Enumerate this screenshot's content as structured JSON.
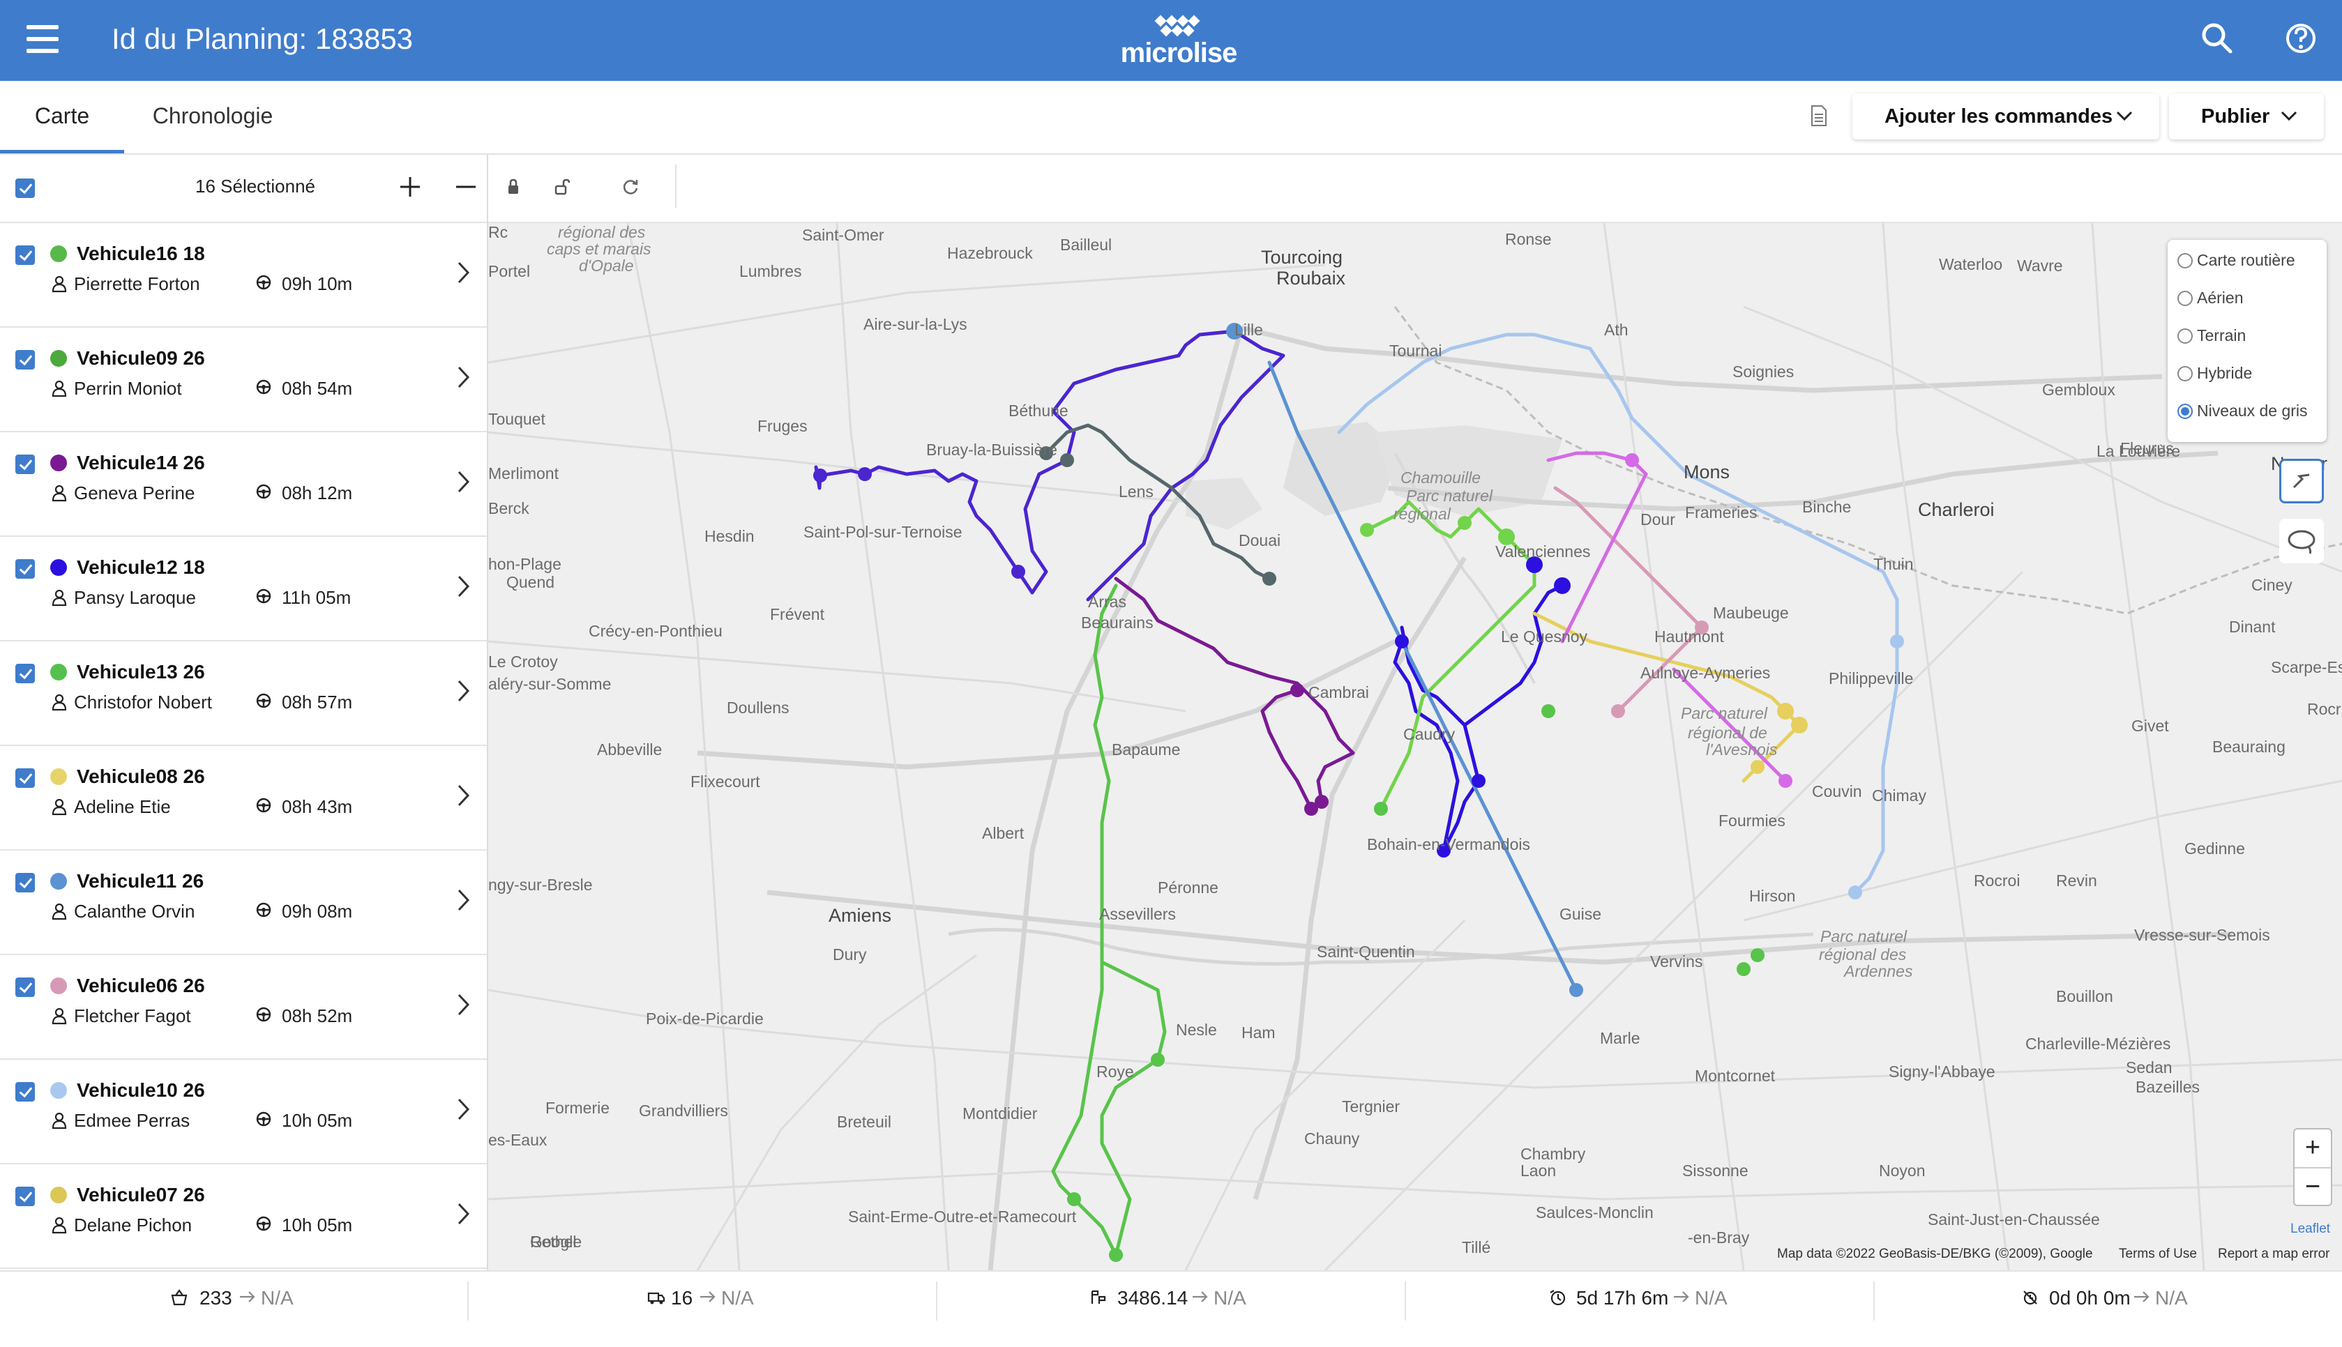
{
  "header": {
    "title": "Id du Planning: 183853",
    "logo_text": "microlise",
    "color": "#3f7ccc"
  },
  "tabs": [
    {
      "label": "Carte",
      "active": true
    },
    {
      "label": "Chronologie",
      "active": false
    }
  ],
  "actions": {
    "add_orders_label": "Ajouter les commandes",
    "publish_label": "Publier"
  },
  "selection": {
    "count_label": "16 Sélectionné"
  },
  "vehicles": [
    {
      "name": "Vehicule16 18",
      "driver": "Pierrette Forton",
      "time": "09h 10m",
      "color": "#58b84a"
    },
    {
      "name": "Vehicule09 26",
      "driver": "Perrin Moniot",
      "time": "08h 54m",
      "color": "#4ca93c"
    },
    {
      "name": "Vehicule14 26",
      "driver": "Geneva Perine",
      "time": "08h 12m",
      "color": "#7a1a93"
    },
    {
      "name": "Vehicule12 18",
      "driver": "Pansy Laroque",
      "time": "11h 05m",
      "color": "#2b10e0"
    },
    {
      "name": "Vehicule13 26",
      "driver": "Christofor Nobert",
      "time": "08h 57m",
      "color": "#55c04e"
    },
    {
      "name": "Vehicule08 26",
      "driver": "Adeline Etie",
      "time": "08h 43m",
      "color": "#e6d46a"
    },
    {
      "name": "Vehicule11 26",
      "driver": "Calanthe Orvin",
      "time": "09h 08m",
      "color": "#5b92d2"
    },
    {
      "name": "Vehicule06 26",
      "driver": "Fletcher Fagot",
      "time": "08h 52m",
      "color": "#d79ab6"
    },
    {
      "name": "Vehicule10 26",
      "driver": "Edmee Perras",
      "time": "10h 05m",
      "color": "#a9c8f0"
    },
    {
      "name": "Vehicule07 26",
      "driver": "Delane Pichon",
      "time": "10h 05m",
      "color": "#dcc756"
    }
  ],
  "map": {
    "layers": [
      {
        "label": "Carte routière",
        "selected": false
      },
      {
        "label": "Aérien",
        "selected": false
      },
      {
        "label": "Terrain",
        "selected": false
      },
      {
        "label": "Hybride",
        "selected": false
      },
      {
        "label": "Niveaux de gris",
        "selected": true
      }
    ],
    "places": [
      {
        "t": "régional des"
      },
      {
        "t": "caps et marais"
      },
      {
        "t": "d'Opale"
      },
      {
        "t": "Saint-Omer"
      },
      {
        "t": "Bailleul"
      },
      {
        "t": "Hazebrouck"
      },
      {
        "t": "Tourcoing"
      },
      {
        "t": "Roubaix"
      },
      {
        "t": "Ronse"
      },
      {
        "t": "Portel"
      },
      {
        "t": "Lumbres"
      },
      {
        "t": "Waterloo"
      },
      {
        "t": "Wavre"
      },
      {
        "t": "Aire-sur-la-Lys"
      },
      {
        "t": "Lille"
      },
      {
        "t": "Tournai"
      },
      {
        "t": "Ath"
      },
      {
        "t": "Soignies"
      },
      {
        "t": "Gembloux"
      },
      {
        "t": "Béthune"
      },
      {
        "t": "Touquet"
      },
      {
        "t": "Fruges"
      },
      {
        "t": "Bruay-la-Buissière"
      },
      {
        "t": "La Louvière"
      },
      {
        "t": "Fleurus"
      },
      {
        "t": "Namur"
      },
      {
        "t": "Merlimont"
      },
      {
        "t": "Lens"
      },
      {
        "t": "Mons"
      },
      {
        "t": "Berck"
      },
      {
        "t": "Frameries"
      },
      {
        "t": "Binche"
      },
      {
        "t": "Charleroi"
      },
      {
        "t": "Dour"
      },
      {
        "t": "Hesdin"
      },
      {
        "t": "Saint-Pol-sur-Ternoise"
      },
      {
        "t": "Douai"
      },
      {
        "t": "hon-Plage"
      },
      {
        "t": "Quend"
      },
      {
        "t": "Valenciennes"
      },
      {
        "t": "Thuin"
      },
      {
        "t": "Arras"
      },
      {
        "t": "Beaurains"
      },
      {
        "t": "Frévent"
      },
      {
        "t": "Maubeuge"
      },
      {
        "t": "Ciney"
      },
      {
        "t": "Crécy-en-Ponthieu"
      },
      {
        "t": "Le Quesnoy"
      },
      {
        "t": "Hautmont"
      },
      {
        "t": "Dinant"
      },
      {
        "t": "Le Crotoy"
      },
      {
        "t": "aléry-sur-Somme"
      },
      {
        "t": "Aulnoye-Aymeries"
      },
      {
        "t": "Philippeville"
      },
      {
        "t": "Cambrai"
      },
      {
        "t": "Parc naturel"
      },
      {
        "t": "régional de"
      },
      {
        "t": "l'Avesnois"
      },
      {
        "t": "Doullens"
      },
      {
        "t": "Givet"
      },
      {
        "t": "Abbeville"
      },
      {
        "t": "Caudry"
      },
      {
        "t": "Beauraing"
      },
      {
        "t": "Bapaume"
      },
      {
        "t": "Chimay"
      },
      {
        "t": "Couvin"
      },
      {
        "t": "Flixecourt"
      },
      {
        "t": "Fourmies"
      },
      {
        "t": "Albert"
      },
      {
        "t": "Bohain-en-Vermandois"
      },
      {
        "t": "Gedinne"
      },
      {
        "t": "Revin"
      },
      {
        "t": "Rocroi"
      },
      {
        "t": "ngy-sur-Bresle"
      },
      {
        "t": "Péronne"
      },
      {
        "t": "Hirson"
      },
      {
        "t": "Amiens"
      },
      {
        "t": "Assevillers"
      },
      {
        "t": "Guise"
      },
      {
        "t": "Parc naturel"
      },
      {
        "t": "Vresse-sur-Semois"
      },
      {
        "t": "Dury"
      },
      {
        "t": "Saint-Quentin"
      },
      {
        "t": "régional des"
      },
      {
        "t": "Ardennes"
      },
      {
        "t": "Vervins"
      },
      {
        "t": "Bouillon"
      },
      {
        "t": "Poix-de-Picardie"
      },
      {
        "t": "Nesle"
      },
      {
        "t": "Ham"
      },
      {
        "t": "Charleville-Mézières"
      },
      {
        "t": "Marle"
      },
      {
        "t": "Roye"
      },
      {
        "t": "Signy-l'Abbaye"
      },
      {
        "t": "Sedan"
      },
      {
        "t": "Montcornet"
      },
      {
        "t": "Bazeilles"
      },
      {
        "t": "Grandvilliers"
      },
      {
        "t": "Formerie"
      },
      {
        "t": "Montdidier"
      },
      {
        "t": "Breteuil"
      },
      {
        "t": "Tergnier"
      },
      {
        "t": "es-Eaux"
      },
      {
        "t": "Chauny"
      },
      {
        "t": "Chambry"
      },
      {
        "t": "Laon"
      },
      {
        "t": "Sissonne"
      },
      {
        "t": "Noyon"
      },
      {
        "t": "Saulces-Monclin"
      },
      {
        "t": "Saint-Erme-Outre-et-Ramecourt"
      },
      {
        "t": "Saint-Just-en-Chaussée"
      },
      {
        "t": "Rethel"
      },
      {
        "t": "Google"
      },
      {
        "t": "-en-Bray"
      },
      {
        "t": "Tillé"
      },
      {
        "t": "Chamouille"
      },
      {
        "t": "Parc naturel"
      },
      {
        "t": "régional"
      },
      {
        "t": "Scarpe-Escaut"
      },
      {
        "t": "Rocr"
      },
      {
        "t": "Rc"
      }
    ],
    "attribution": "Map data ©2022 GeoBasis-DE/BKG (©2009), Google",
    "terms": "Terms of Use",
    "report": "Report a map error",
    "leaflet": "Leaflet"
  },
  "footer": {
    "stats": [
      {
        "icon": "basket-icon",
        "value": "233",
        "target": "N/A"
      },
      {
        "icon": "truck-icon",
        "value": "16",
        "target": "N/A"
      },
      {
        "icon": "distance-icon",
        "value": "3486.14",
        "target": "N/A"
      },
      {
        "icon": "duration-icon",
        "value": "5d 17h 6m",
        "target": "N/A"
      },
      {
        "icon": "idle-icon",
        "value": "0d 0h 0m",
        "target": "N/A"
      }
    ]
  }
}
